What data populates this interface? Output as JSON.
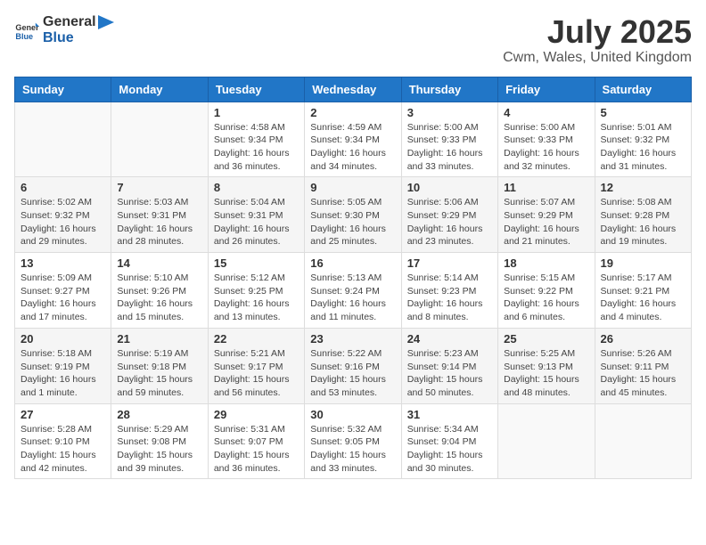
{
  "logo": {
    "text_general": "General",
    "text_blue": "Blue"
  },
  "title": "July 2025",
  "subtitle": "Cwm, Wales, United Kingdom",
  "headers": [
    "Sunday",
    "Monday",
    "Tuesday",
    "Wednesday",
    "Thursday",
    "Friday",
    "Saturday"
  ],
  "weeks": [
    [
      {
        "day": "",
        "info": ""
      },
      {
        "day": "",
        "info": ""
      },
      {
        "day": "1",
        "info": "Sunrise: 4:58 AM\nSunset: 9:34 PM\nDaylight: 16 hours and 36 minutes."
      },
      {
        "day": "2",
        "info": "Sunrise: 4:59 AM\nSunset: 9:34 PM\nDaylight: 16 hours and 34 minutes."
      },
      {
        "day": "3",
        "info": "Sunrise: 5:00 AM\nSunset: 9:33 PM\nDaylight: 16 hours and 33 minutes."
      },
      {
        "day": "4",
        "info": "Sunrise: 5:00 AM\nSunset: 9:33 PM\nDaylight: 16 hours and 32 minutes."
      },
      {
        "day": "5",
        "info": "Sunrise: 5:01 AM\nSunset: 9:32 PM\nDaylight: 16 hours and 31 minutes."
      }
    ],
    [
      {
        "day": "6",
        "info": "Sunrise: 5:02 AM\nSunset: 9:32 PM\nDaylight: 16 hours and 29 minutes."
      },
      {
        "day": "7",
        "info": "Sunrise: 5:03 AM\nSunset: 9:31 PM\nDaylight: 16 hours and 28 minutes."
      },
      {
        "day": "8",
        "info": "Sunrise: 5:04 AM\nSunset: 9:31 PM\nDaylight: 16 hours and 26 minutes."
      },
      {
        "day": "9",
        "info": "Sunrise: 5:05 AM\nSunset: 9:30 PM\nDaylight: 16 hours and 25 minutes."
      },
      {
        "day": "10",
        "info": "Sunrise: 5:06 AM\nSunset: 9:29 PM\nDaylight: 16 hours and 23 minutes."
      },
      {
        "day": "11",
        "info": "Sunrise: 5:07 AM\nSunset: 9:29 PM\nDaylight: 16 hours and 21 minutes."
      },
      {
        "day": "12",
        "info": "Sunrise: 5:08 AM\nSunset: 9:28 PM\nDaylight: 16 hours and 19 minutes."
      }
    ],
    [
      {
        "day": "13",
        "info": "Sunrise: 5:09 AM\nSunset: 9:27 PM\nDaylight: 16 hours and 17 minutes."
      },
      {
        "day": "14",
        "info": "Sunrise: 5:10 AM\nSunset: 9:26 PM\nDaylight: 16 hours and 15 minutes."
      },
      {
        "day": "15",
        "info": "Sunrise: 5:12 AM\nSunset: 9:25 PM\nDaylight: 16 hours and 13 minutes."
      },
      {
        "day": "16",
        "info": "Sunrise: 5:13 AM\nSunset: 9:24 PM\nDaylight: 16 hours and 11 minutes."
      },
      {
        "day": "17",
        "info": "Sunrise: 5:14 AM\nSunset: 9:23 PM\nDaylight: 16 hours and 8 minutes."
      },
      {
        "day": "18",
        "info": "Sunrise: 5:15 AM\nSunset: 9:22 PM\nDaylight: 16 hours and 6 minutes."
      },
      {
        "day": "19",
        "info": "Sunrise: 5:17 AM\nSunset: 9:21 PM\nDaylight: 16 hours and 4 minutes."
      }
    ],
    [
      {
        "day": "20",
        "info": "Sunrise: 5:18 AM\nSunset: 9:19 PM\nDaylight: 16 hours and 1 minute."
      },
      {
        "day": "21",
        "info": "Sunrise: 5:19 AM\nSunset: 9:18 PM\nDaylight: 15 hours and 59 minutes."
      },
      {
        "day": "22",
        "info": "Sunrise: 5:21 AM\nSunset: 9:17 PM\nDaylight: 15 hours and 56 minutes."
      },
      {
        "day": "23",
        "info": "Sunrise: 5:22 AM\nSunset: 9:16 PM\nDaylight: 15 hours and 53 minutes."
      },
      {
        "day": "24",
        "info": "Sunrise: 5:23 AM\nSunset: 9:14 PM\nDaylight: 15 hours and 50 minutes."
      },
      {
        "day": "25",
        "info": "Sunrise: 5:25 AM\nSunset: 9:13 PM\nDaylight: 15 hours and 48 minutes."
      },
      {
        "day": "26",
        "info": "Sunrise: 5:26 AM\nSunset: 9:11 PM\nDaylight: 15 hours and 45 minutes."
      }
    ],
    [
      {
        "day": "27",
        "info": "Sunrise: 5:28 AM\nSunset: 9:10 PM\nDaylight: 15 hours and 42 minutes."
      },
      {
        "day": "28",
        "info": "Sunrise: 5:29 AM\nSunset: 9:08 PM\nDaylight: 15 hours and 39 minutes."
      },
      {
        "day": "29",
        "info": "Sunrise: 5:31 AM\nSunset: 9:07 PM\nDaylight: 15 hours and 36 minutes."
      },
      {
        "day": "30",
        "info": "Sunrise: 5:32 AM\nSunset: 9:05 PM\nDaylight: 15 hours and 33 minutes."
      },
      {
        "day": "31",
        "info": "Sunrise: 5:34 AM\nSunset: 9:04 PM\nDaylight: 15 hours and 30 minutes."
      },
      {
        "day": "",
        "info": ""
      },
      {
        "day": "",
        "info": ""
      }
    ]
  ]
}
